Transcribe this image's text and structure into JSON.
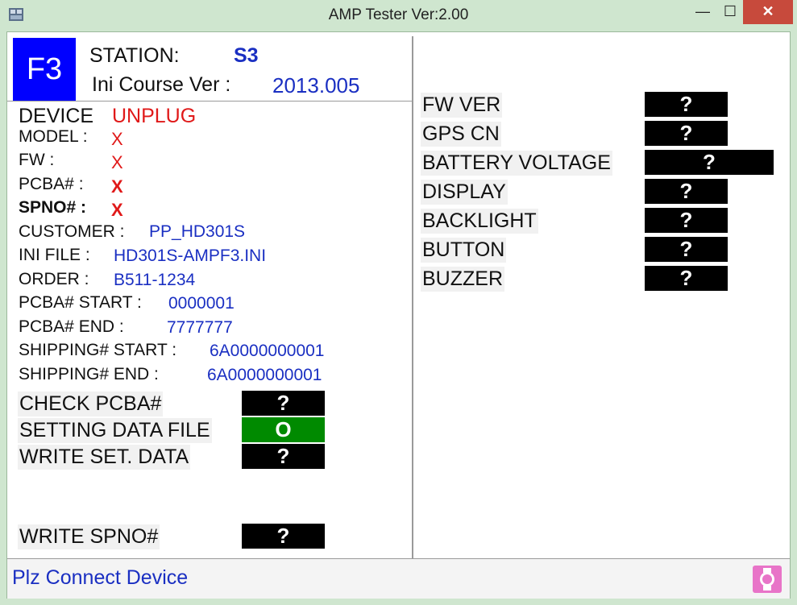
{
  "window": {
    "title": "AMP Tester Ver:2.00"
  },
  "header": {
    "badge": "F3",
    "station_label": "STATION:",
    "station_value": "S3",
    "ini_label": "Ini Course Ver :",
    "ini_value": "2013.005"
  },
  "device": {
    "label": "DEVICE",
    "state": "UNPLUG",
    "fields": [
      {
        "label": "MODEL :",
        "value": "X"
      },
      {
        "label": "FW :",
        "value": "X"
      },
      {
        "label": "PCBA# :",
        "value": "X"
      },
      {
        "label": "SPNO# :",
        "value": "X"
      },
      {
        "label": "CUSTOMER :",
        "value": "PP_HD301S"
      },
      {
        "label": "INI FILE :",
        "value": "HD301S-AMPF3.INI"
      },
      {
        "label": "ORDER :",
        "value": "B511-1234"
      },
      {
        "label": "PCBA# START :",
        "value": "0000001"
      },
      {
        "label": "PCBA# END :",
        "value": "7777777"
      },
      {
        "label": "SHIPPING# START :",
        "value": "6A0000000001"
      },
      {
        "label": "SHIPPING# END :",
        "value": "6A0000000001"
      }
    ]
  },
  "left_tests": [
    {
      "label": "CHECK PCBA#",
      "result": "?"
    },
    {
      "label": "SETTING DATA FILE",
      "result": "O"
    },
    {
      "label": "WRITE SET. DATA",
      "result": "?"
    },
    {
      "label": "WRITE SPNO#",
      "result": "?"
    }
  ],
  "right_tests": [
    {
      "label": "FW VER",
      "result": "?"
    },
    {
      "label": "GPS CN",
      "result": "?"
    },
    {
      "label": "BATTERY VOLTAGE",
      "result": "?"
    },
    {
      "label": "DISPLAY",
      "result": "?"
    },
    {
      "label": "BACKLIGHT",
      "result": "?"
    },
    {
      "label": "BUTTON",
      "result": "?"
    },
    {
      "label": "BUZZER",
      "result": "?"
    }
  ],
  "status": {
    "message": "Plz Connect Device",
    "icon": "watch-icon"
  },
  "colors": {
    "pass": "#008a00",
    "pending": "#000000",
    "accent_blue": "#1a2fc2",
    "fail_red": "#e01919",
    "badge_blue": "#0000ff"
  }
}
